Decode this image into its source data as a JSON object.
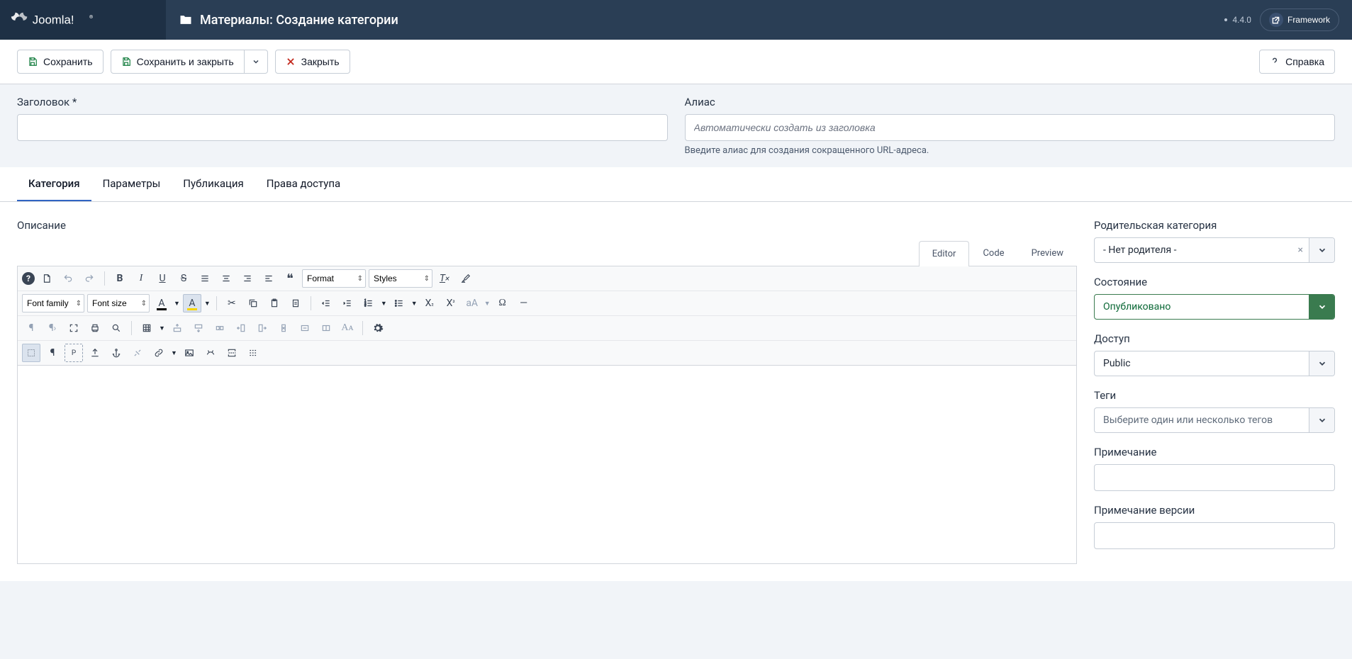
{
  "header": {
    "page_title": "Материалы: Создание категории",
    "version": "4.4.0",
    "framework_label": "Framework"
  },
  "toolbar": {
    "save": "Сохранить",
    "save_close": "Сохранить и закрыть",
    "close": "Закрыть",
    "help": "Справка"
  },
  "form": {
    "title_label": "Заголовок *",
    "title_value": "",
    "alias_label": "Алиас",
    "alias_placeholder": "Автоматически создать из заголовка",
    "alias_hint": "Введите алиас для создания сокращенного URL-адреса."
  },
  "tabs": {
    "category": "Категория",
    "params": "Параметры",
    "publishing": "Публикация",
    "permissions": "Права доступа"
  },
  "editor": {
    "label": "Описание",
    "tab_editor": "Editor",
    "tab_code": "Code",
    "tab_preview": "Preview",
    "format": "Format",
    "styles": "Styles",
    "font_family": "Font family",
    "font_size": "Font size"
  },
  "sidebar": {
    "parent_label": "Родительская категория",
    "parent_value": "- Нет родителя -",
    "state_label": "Состояние",
    "state_value": "Опубликовано",
    "access_label": "Доступ",
    "access_value": "Public",
    "tags_label": "Теги",
    "tags_placeholder": "Выберите один или несколько тегов",
    "note_label": "Примечание",
    "version_note_label": "Примечание версии"
  }
}
